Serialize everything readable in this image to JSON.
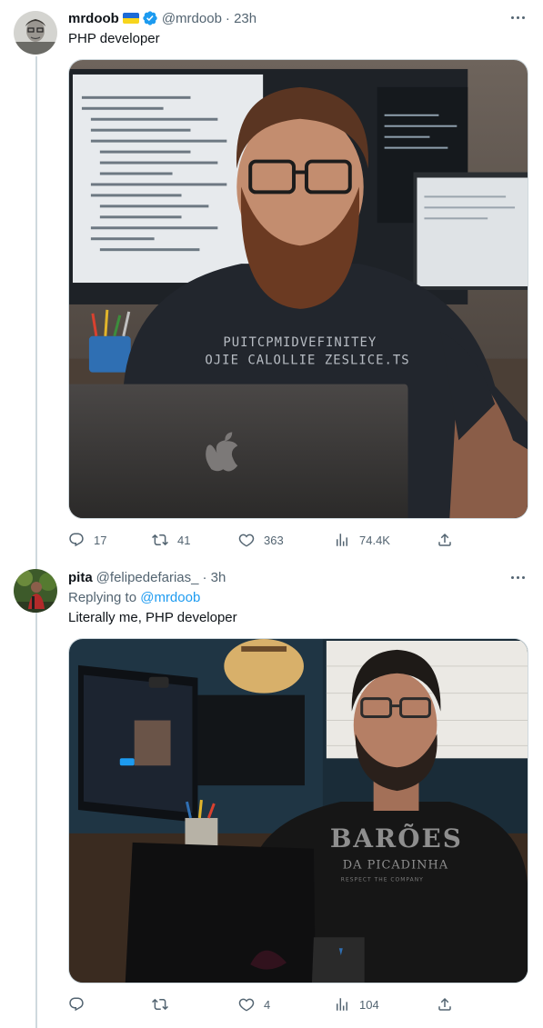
{
  "tweets": [
    {
      "display_name": "mrdoob",
      "flag_icon": "ukraine-flag-icon",
      "verified_icon": "verified-badge-icon",
      "handle": "@mrdoob",
      "time": "· 23h",
      "text": "PHP developer",
      "media_alt": "AI-generated portrait of a bearded developer at a laptop",
      "shirt_text_line1": "PUITCPMIDVEFINITEY",
      "shirt_text_line2": "OJIE CALOLLIE ZESLICE.TS",
      "actions": {
        "replies": "17",
        "retweets": "41",
        "likes": "363",
        "views": "74.4K"
      }
    },
    {
      "display_name": "pita",
      "handle": "@felipedefarias_",
      "time": "· 3h",
      "replying_to_label": "Replying to",
      "replying_to_handle": "@mrdoob",
      "text": "Literally me, PHP developer",
      "media_alt": "Photo of a bearded developer at a laptop",
      "shirt_text_line1": "BARÕES",
      "shirt_text_line2": "DA PICADINHA",
      "shirt_text_line3": "RESPECT THE COMPANY",
      "actions": {
        "replies": "",
        "retweets": "",
        "likes": "4",
        "views": "104"
      }
    }
  ],
  "icons": {
    "reply": "reply-icon",
    "retweet": "retweet-icon",
    "like": "heart-icon",
    "views": "views-icon",
    "share": "share-icon",
    "more": "more-icon"
  },
  "colors": {
    "text_primary": "#0f1419",
    "text_secondary": "#536471",
    "accent": "#1d9bf0",
    "border": "#cfd9de"
  }
}
